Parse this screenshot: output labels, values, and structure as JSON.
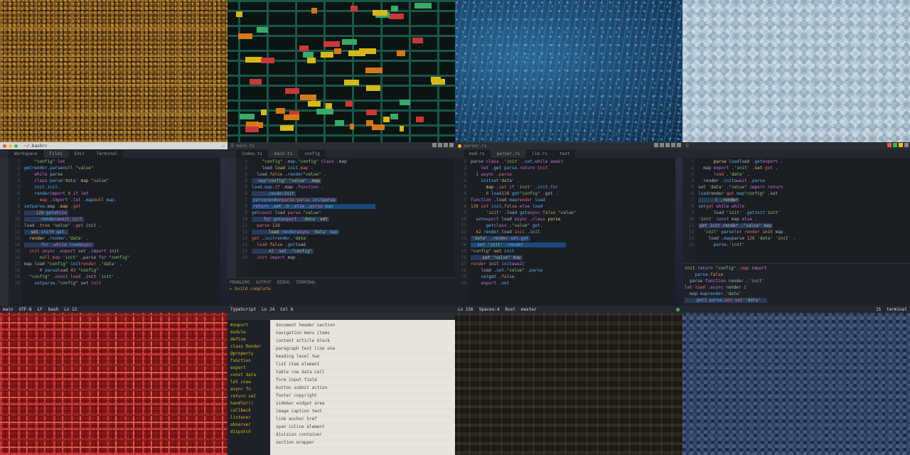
{
  "row2": {
    "editor1": {
      "addressbar": "~/.bashrc",
      "tabs": [
        "Workspace",
        "Files",
        "Edit",
        "Terminal"
      ],
      "status": [
        "main",
        "UTF-8",
        "LF",
        "bash",
        "Ln 12"
      ],
      "lines_a": 18
    },
    "editor2": {
      "title": "main.ts",
      "tabs": [
        "index.ts",
        "main.ts",
        "config"
      ],
      "bottom_tabs": [
        "PROBLEMS",
        "OUTPUT",
        "DEBUG",
        "TERMINAL"
      ],
      "status": [
        "TypeScript",
        "Ln 24",
        "Col 8"
      ],
      "lines_a": 16
    },
    "editor3": {
      "title": "parser.rs",
      "tabs": [
        "mod.rs",
        "parser.rs",
        "lib.rs",
        "test"
      ],
      "status": [
        "master",
        "Rust",
        "Spaces:4",
        "Ln 156"
      ],
      "lines_a": 18
    },
    "editor4": {
      "title": "",
      "tabs": [
        ""
      ],
      "status": [
        "JS",
        "terminal"
      ],
      "lines_a": 16
    }
  },
  "row3": {
    "listpanel": {
      "left": [
        "#import",
        "module",
        "define",
        "class Render",
        "@property",
        "function",
        "export",
        "const data",
        "let view",
        "async fn",
        "return val",
        "handler()",
        "callback",
        "listener",
        "observer",
        "dispatch"
      ],
      "right": [
        "document header section",
        "navigation menu items",
        "content article block",
        "paragraph text line one",
        "heading level two",
        "list item element",
        "table row data cell",
        "form input field",
        "button submit action",
        "footer copyright",
        "sidebar widget area",
        "image caption text",
        "link anchor href",
        "span inline element",
        "division container",
        "section wrapper"
      ]
    }
  },
  "tokens": {
    "kw": [
      "const",
      "let",
      "function",
      "return",
      "if",
      "else",
      "import",
      "export",
      "class",
      "async",
      "await",
      "for",
      "while"
    ],
    "str": [
      "'data'",
      "\"value\"",
      "'init'",
      "\"config\""
    ],
    "fn": [
      "render",
      "parse",
      "init",
      "load",
      "map",
      "get",
      "set"
    ],
    "num": [
      "0",
      "1",
      "42",
      "128",
      "true",
      "false",
      "null"
    ]
  }
}
